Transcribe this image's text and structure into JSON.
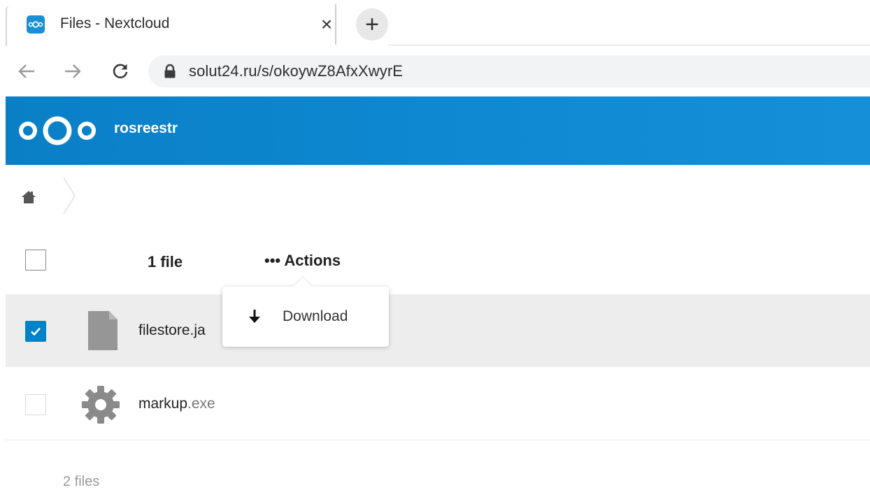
{
  "browser": {
    "tab": {
      "title": "Files - Nextcloud",
      "close_glyph": "×",
      "favicon": "nextcloud-favicon-icon"
    },
    "new_tab_glyph": "+",
    "url": "solut24.ru/s/okoywZ8AfxXwyrE"
  },
  "header": {
    "app_name": "rosreestr",
    "color": "#0082c9"
  },
  "file_list": {
    "count_label": "1 file",
    "actions_label": "••• Actions",
    "files": [
      {
        "name": "filestore.ja",
        "ext": "",
        "selected": true,
        "icon": "file-icon"
      },
      {
        "name": "markup",
        "ext": ".exe",
        "selected": false,
        "icon": "gear-icon"
      }
    ],
    "summary": "2 files"
  },
  "popover": {
    "download_label": "Download"
  }
}
